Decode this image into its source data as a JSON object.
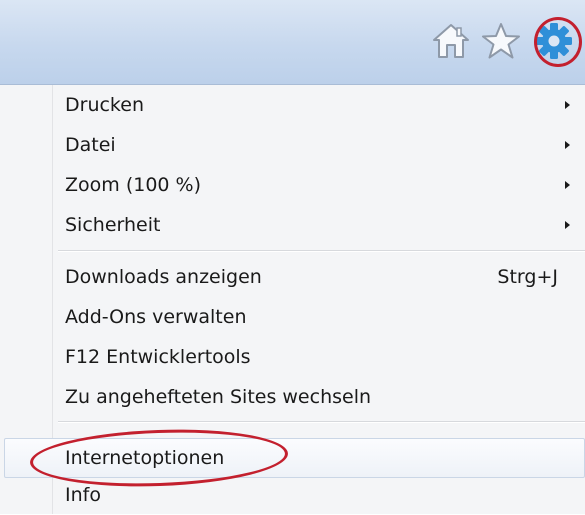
{
  "toolbar": {
    "icons": [
      "home-icon",
      "favorites-star-icon",
      "tools-gear-icon"
    ],
    "highlight_color": "#c3202e"
  },
  "menu": {
    "groups": [
      {
        "items": [
          {
            "label": "Drucken",
            "submenu": true
          },
          {
            "label": "Datei",
            "submenu": true
          },
          {
            "label": "Zoom (100 %)",
            "submenu": true
          },
          {
            "label": "Sicherheit",
            "submenu": true
          }
        ]
      },
      {
        "items": [
          {
            "label": "Downloads anzeigen",
            "shortcut": "Strg+J"
          },
          {
            "label": "Add-Ons verwalten"
          },
          {
            "label": "F12 Entwicklertools"
          },
          {
            "label": "Zu angehefteten Sites wechseln"
          }
        ]
      },
      {
        "items": [
          {
            "label": "Internetoptionen",
            "hovered": true,
            "annotated": true
          },
          {
            "label": "Info"
          }
        ]
      }
    ]
  }
}
